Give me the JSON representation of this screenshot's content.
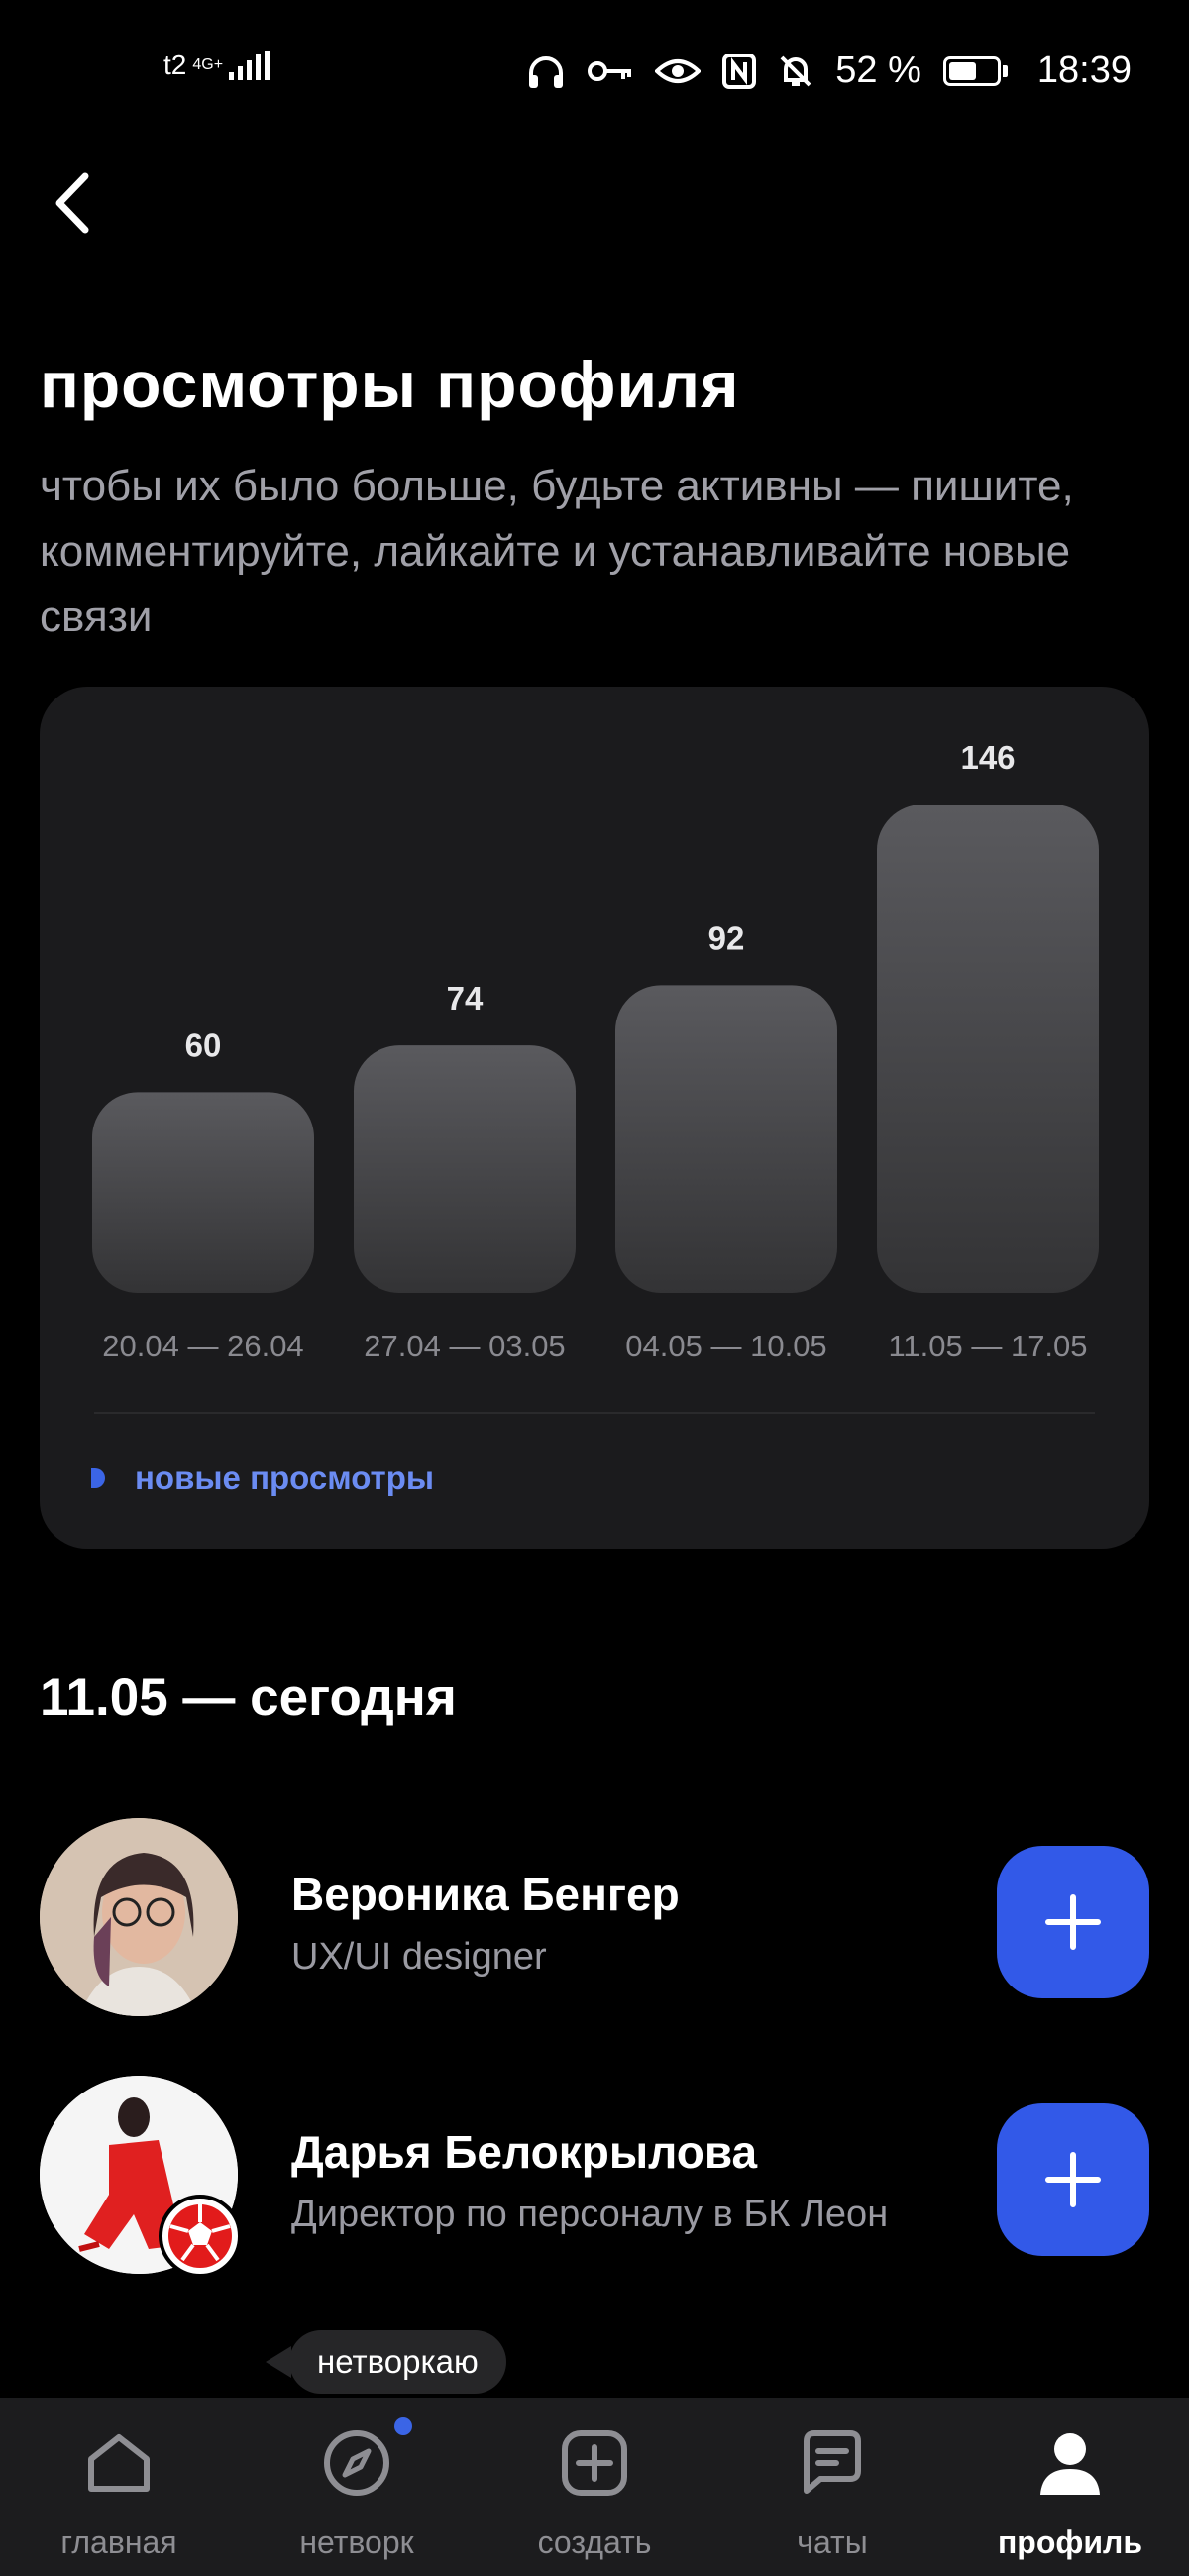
{
  "status_bar": {
    "carrier": "t2",
    "network": "4G+",
    "battery_percent": "52 %",
    "battery_level": 0.52,
    "time": "18:39",
    "icons": [
      "headphones-icon",
      "key-icon",
      "eye-icon",
      "nfc-icon",
      "mute-bell-icon",
      "battery-icon"
    ]
  },
  "header": {
    "back_icon": "chevron-left-icon",
    "title": "просмотры профиля",
    "subtitle": "чтобы их было больше, будьте активны — пишите, комментируйте, лайкайте и устанавливайте новые связи"
  },
  "chart_data": {
    "type": "bar",
    "categories": [
      "20.04 — 26.04",
      "27.04 — 03.05",
      "04.05 — 10.05",
      "11.05 — 17.05"
    ],
    "values": [
      60,
      74,
      92,
      146
    ],
    "legend": [
      {
        "label": "новые просмотры",
        "color": "#3b65e6"
      }
    ],
    "legend_position": "bottom-left",
    "grid": false
  },
  "section_title": "11.05 — сегодня",
  "people": [
    {
      "name": "Вероника Бенгер",
      "role": "UX/UI designer",
      "avatar_icon": "avatar-photo"
    },
    {
      "name": "Дарья Белокрылова",
      "role": "Директор по персоналу в БК Леон",
      "avatar_icon": "avatar-photo",
      "badge_icon": "football-badge-icon"
    }
  ],
  "tooltip": "нетворкаю",
  "nav": {
    "items": [
      {
        "label": "главная",
        "icon": "home-icon"
      },
      {
        "label": "нетворк",
        "icon": "compass-icon",
        "has_badge": true
      },
      {
        "label": "создать",
        "icon": "plus-square-icon"
      },
      {
        "label": "чаты",
        "icon": "chat-icon"
      },
      {
        "label": "профиль",
        "icon": "person-icon",
        "active": true
      }
    ]
  },
  "colors": {
    "accent": "#3259e8",
    "background": "#000000",
    "card": "#1b1b1d",
    "legend_text": "#6b8cf2"
  }
}
